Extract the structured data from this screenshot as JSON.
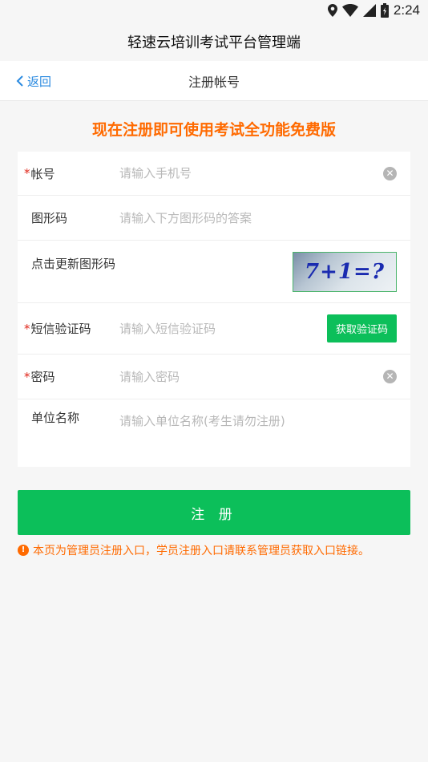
{
  "status_bar": {
    "time": "2:24",
    "icons": [
      "location-icon",
      "wifi-icon",
      "signal-icon",
      "battery-icon"
    ]
  },
  "app": {
    "title": "轻速云培训考试平台管理端"
  },
  "nav": {
    "back_label": "返回",
    "title": "注册帐号"
  },
  "promo": "现在注册即可使用考试全功能免费版",
  "form": {
    "account": {
      "required_mark": "*",
      "label": "帐号",
      "placeholder": "请输入手机号"
    },
    "captcha_answer": {
      "label": "图形码",
      "placeholder": "请输入下方图形码的答案"
    },
    "captcha_refresh": {
      "label": "点击更新图形码",
      "image_text": "7+1=?"
    },
    "sms": {
      "required_mark": "*",
      "label": "短信验证码",
      "placeholder": "请输入短信验证码",
      "button": "获取验证码"
    },
    "password": {
      "required_mark": "*",
      "label": "密码",
      "placeholder": "请输入密码"
    },
    "org": {
      "label": "单位名称",
      "placeholder": "请输入单位名称(考生请勿注册)"
    }
  },
  "submit_label": "注 册",
  "notice": "本页为管理员注册入口，学员注册入口请联系管理员获取入口链接。",
  "colors": {
    "accent_green": "#0cbf5a",
    "warning_orange": "#ff6a00",
    "link_blue": "#2a8ae0",
    "required_red": "#e0261a"
  }
}
